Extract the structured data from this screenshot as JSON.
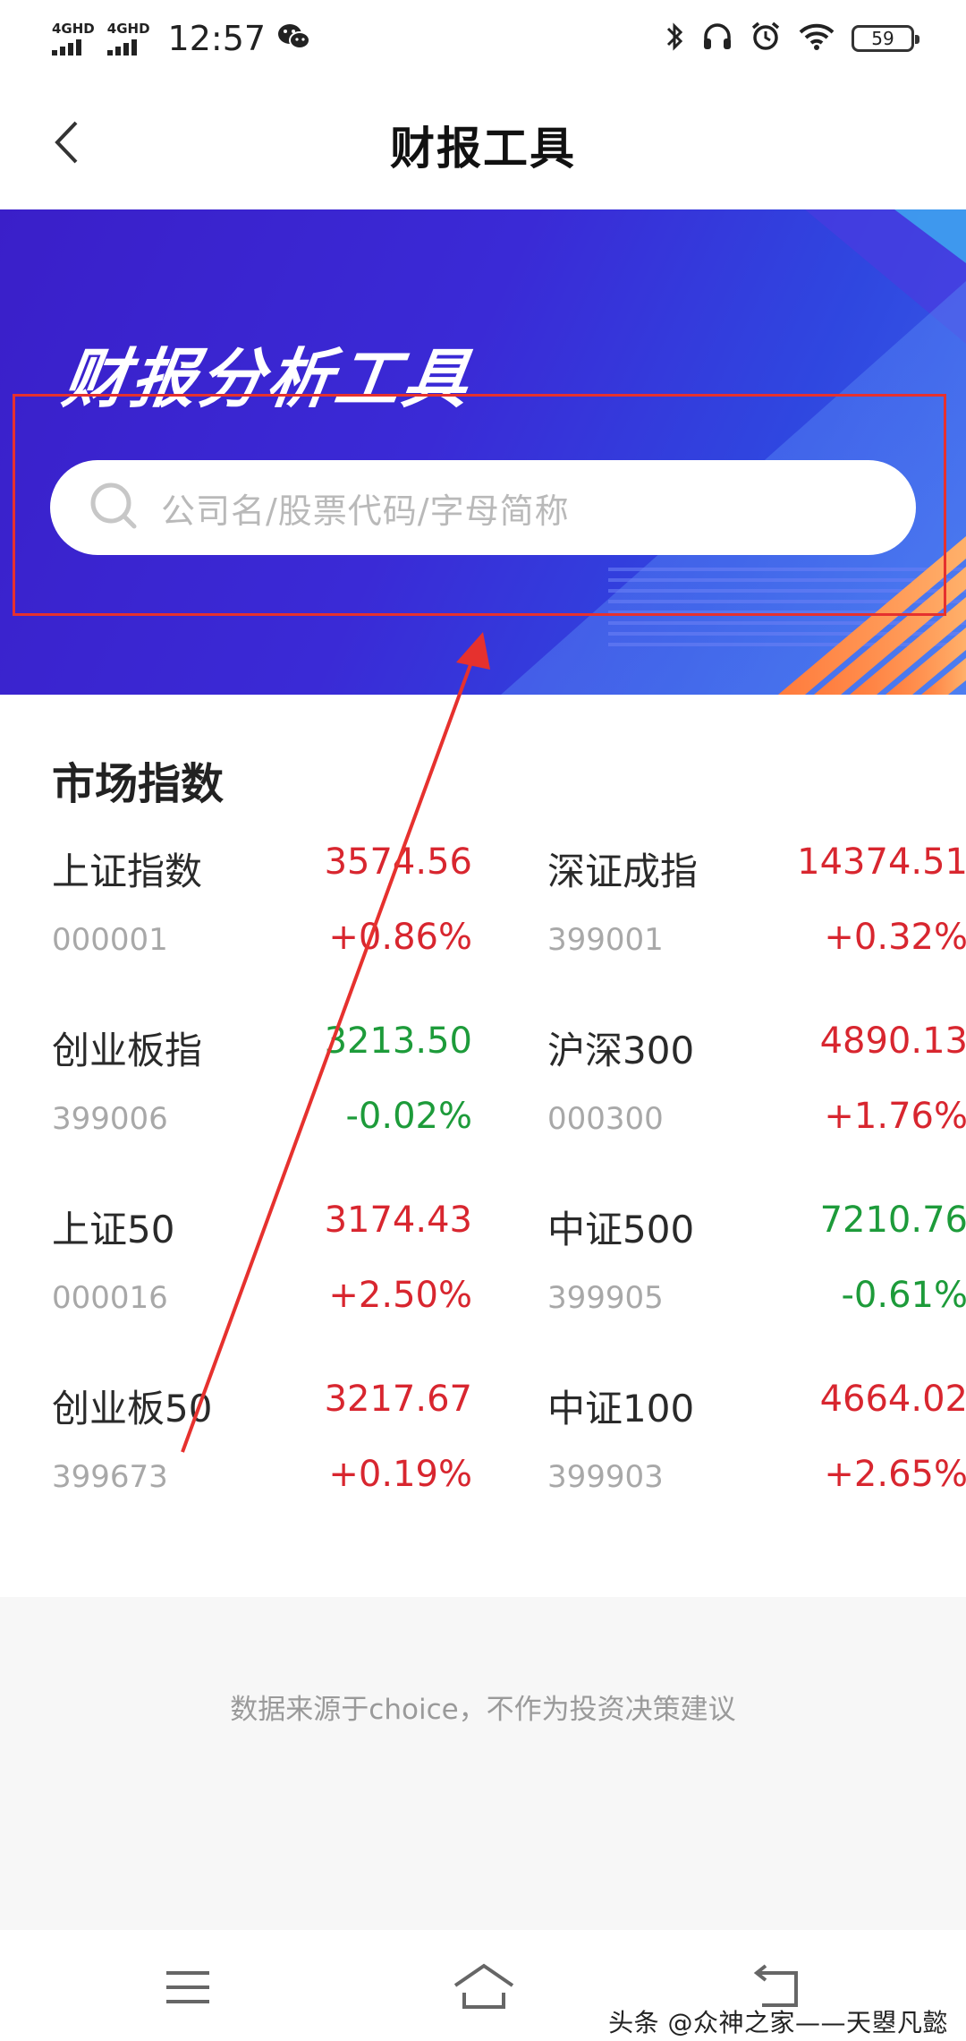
{
  "status_bar": {
    "signal_labels": [
      "4GHD",
      "4GHD"
    ],
    "time": "12:57",
    "battery": "59",
    "icons": [
      "wechat-icon",
      "bluetooth-icon",
      "headphones-icon",
      "alarm-icon",
      "wifi-icon"
    ]
  },
  "header": {
    "title": "财报工具",
    "back_icon": "chevron-left-icon"
  },
  "banner": {
    "title": "财报分析工具",
    "search_placeholder": "公司名/股票代码/字母简称",
    "search_icon": "search-icon",
    "highlight_color": "#e6312e"
  },
  "market": {
    "title": "市场指数",
    "indices": [
      {
        "name": "上证指数",
        "code": "000001",
        "value": "3574.56",
        "change": "+0.86%",
        "trend": "up"
      },
      {
        "name": "深证成指",
        "code": "399001",
        "value": "14374.51",
        "change": "+0.32%",
        "trend": "up"
      },
      {
        "name": "创业板指",
        "code": "399006",
        "value": "3213.50",
        "change": "-0.02%",
        "trend": "down"
      },
      {
        "name": "沪深300",
        "code": "000300",
        "value": "4890.13",
        "change": "+1.76%",
        "trend": "up"
      },
      {
        "name": "上证50",
        "code": "000016",
        "value": "3174.43",
        "change": "+2.50%",
        "trend": "up"
      },
      {
        "name": "中证500",
        "code": "399905",
        "value": "7210.76",
        "change": "-0.61%",
        "trend": "down"
      },
      {
        "name": "创业板50",
        "code": "399673",
        "value": "3217.67",
        "change": "+0.19%",
        "trend": "up"
      },
      {
        "name": "中证100",
        "code": "399903",
        "value": "4664.02",
        "change": "+2.65%",
        "trend": "up"
      }
    ]
  },
  "footer": {
    "note": "数据来源于choice，不作为投资决策建议"
  },
  "nav_bar": {
    "icons": [
      "menu-icon",
      "home-icon",
      "back-icon"
    ]
  },
  "watermark": "头条 @众神之家——天曌凡懿",
  "colors": {
    "up": "#d8262f",
    "down": "#1d9b3a",
    "banner_primary": "#3a2ad6",
    "annotation": "#e6312e"
  }
}
